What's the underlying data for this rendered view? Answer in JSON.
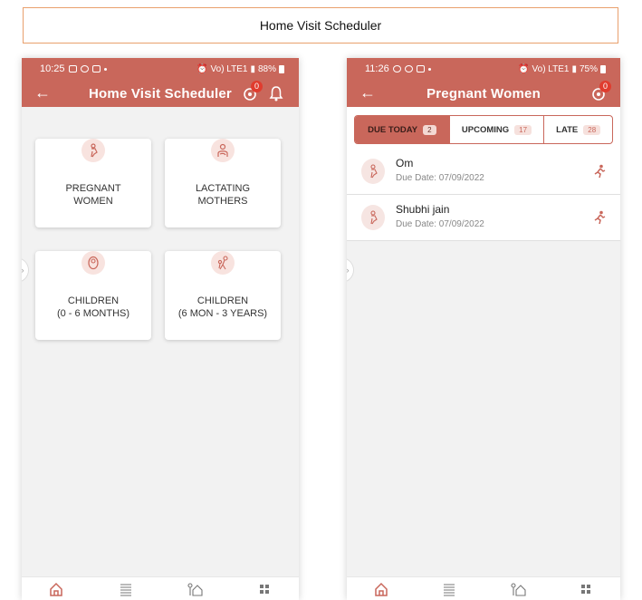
{
  "page_title": "Home Visit Scheduler",
  "left_phone": {
    "status": {
      "time": "10:25",
      "signal": "Vo) LTE1",
      "battery": "88%"
    },
    "appbar": {
      "title": "Home Visit Scheduler",
      "badge": "0"
    },
    "tiles": [
      {
        "line1": "PREGNANT",
        "line2": "WOMEN",
        "icon": "pregnant-woman-icon"
      },
      {
        "line1": "LACTATING",
        "line2": "MOTHERS",
        "icon": "lactating-mother-icon"
      },
      {
        "line1": "CHILDREN",
        "line2": "(0 - 6 MONTHS)",
        "icon": "infant-icon"
      },
      {
        "line1": "CHILDREN",
        "line2": "(6 MON - 3 YEARS)",
        "icon": "toddler-icon"
      }
    ]
  },
  "right_phone": {
    "status": {
      "time": "11:26",
      "signal": "Vo) LTE1",
      "battery": "75%"
    },
    "appbar": {
      "title": "Pregnant Women",
      "badge": "0"
    },
    "tabs": [
      {
        "label": "DUE TODAY",
        "count": "2",
        "active": true
      },
      {
        "label": "UPCOMING",
        "count": "17",
        "active": false
      },
      {
        "label": "LATE",
        "count": "28",
        "active": false
      }
    ],
    "list": [
      {
        "name": "Om",
        "due": "Due Date: 07/09/2022"
      },
      {
        "name": "Shubhi jain",
        "due": "Due Date: 07/09/2022"
      }
    ]
  },
  "bottom_nav": [
    "home-icon",
    "list-icon",
    "house-visit-icon",
    "grid-icon"
  ],
  "colors": {
    "accent": "#c9675b",
    "badge": "#e03c2e",
    "title_border": "#e9a06d"
  }
}
